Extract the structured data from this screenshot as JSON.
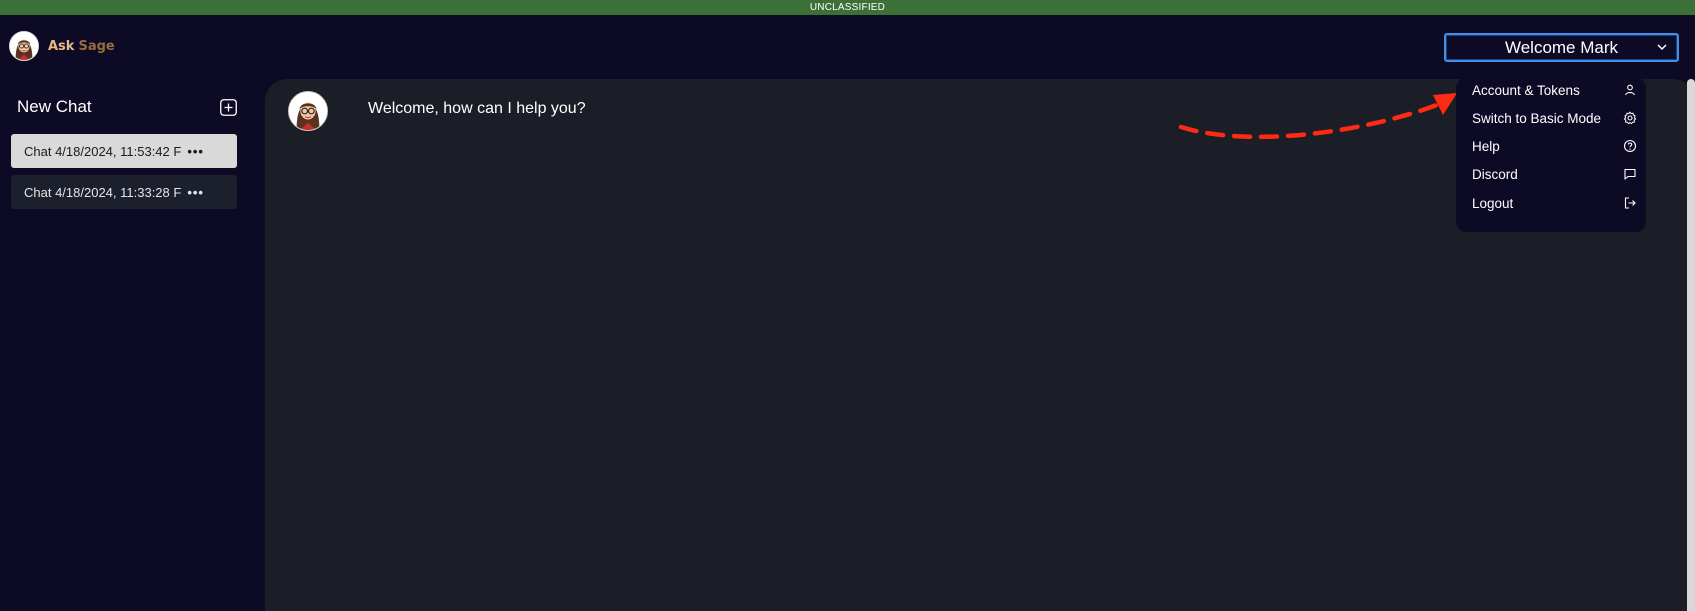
{
  "banner": {
    "classification": "UNCLASSIFIED"
  },
  "brand": {
    "ask": "Ask",
    "sage": "Sage"
  },
  "header": {
    "welcome_label": "Welcome Mark"
  },
  "sidebar": {
    "new_chat_label": "New Chat",
    "chats": [
      {
        "label": "Chat 4/18/2024, 11:53:42 F",
        "more": "•••",
        "active": true
      },
      {
        "label": "Chat 4/18/2024, 11:33:28 F",
        "more": "•••",
        "active": false
      }
    ]
  },
  "conversation": {
    "messages": [
      {
        "role": "assistant",
        "text": "Welcome, how can I help you?"
      }
    ]
  },
  "user_menu": {
    "items": [
      {
        "label": "Account & Tokens",
        "icon": "user-icon"
      },
      {
        "label": "Switch to Basic Mode",
        "icon": "gear-icon"
      },
      {
        "label": "Help",
        "icon": "help-circle-icon"
      },
      {
        "label": "Discord",
        "icon": "chat-bubble-icon"
      },
      {
        "label": "Logout",
        "icon": "logout-icon"
      }
    ]
  },
  "colors": {
    "background": "#0d0a26",
    "panel": "#1b1e26",
    "banner": "#3c7038",
    "accent_border": "#3f8fe8",
    "annotation_arrow": "#ff2a12",
    "brand_ask": "#e9b88a",
    "brand_sage": "#9a6a3d"
  }
}
